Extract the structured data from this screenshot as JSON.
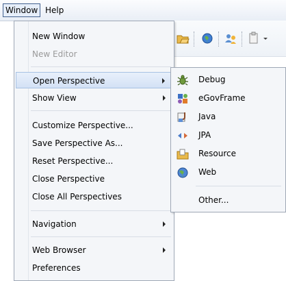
{
  "menubar": {
    "items": [
      {
        "label": "Window"
      },
      {
        "label": "Help"
      }
    ]
  },
  "window_menu": {
    "items": [
      {
        "label": "New Window"
      },
      {
        "label": "New Editor"
      },
      {
        "label": "Open Perspective"
      },
      {
        "label": "Show View"
      },
      {
        "label": "Customize Perspective..."
      },
      {
        "label": "Save Perspective As..."
      },
      {
        "label": "Reset Perspective..."
      },
      {
        "label": "Close Perspective"
      },
      {
        "label": "Close All Perspectives"
      },
      {
        "label": "Navigation"
      },
      {
        "label": "Web Browser"
      },
      {
        "label": "Preferences"
      }
    ]
  },
  "open_perspective_menu": {
    "items": [
      {
        "label": "Debug",
        "icon": "debug-bug-icon"
      },
      {
        "label": "eGovFrame",
        "icon": "egovframe-icon"
      },
      {
        "label": "Java",
        "icon": "java-icon"
      },
      {
        "label": "JPA",
        "icon": "jpa-arrows-icon"
      },
      {
        "label": "Resource",
        "icon": "resource-folder-icon"
      },
      {
        "label": "Web",
        "icon": "web-globe-icon"
      },
      {
        "label": "Other..."
      }
    ]
  },
  "colors": {
    "highlight": "#d3e1f5",
    "menu_background": "#f4f6f9",
    "disabled_text": "#9a9a9a"
  }
}
